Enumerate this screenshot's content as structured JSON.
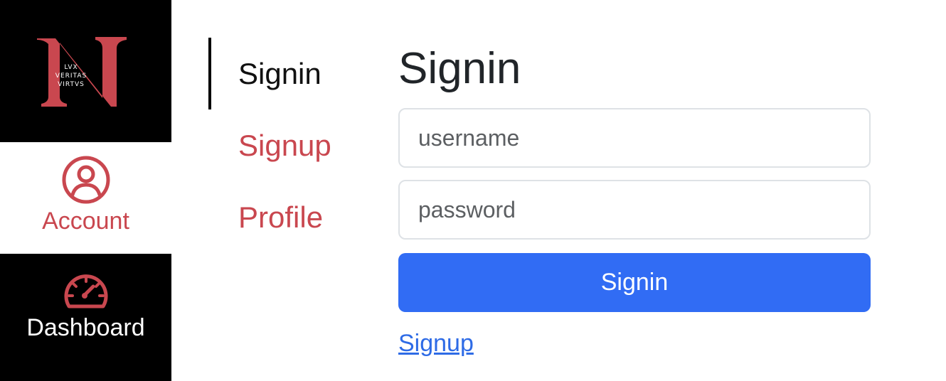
{
  "rail": {
    "logo": {
      "letter": "N",
      "motto_lines": [
        "LVX",
        "VERITAS",
        "VIRTVS"
      ]
    },
    "items": [
      {
        "label": "Account",
        "icon": "user-circle-icon",
        "active": true
      },
      {
        "label": "Dashboard",
        "icon": "speedometer-icon",
        "active": false
      }
    ]
  },
  "subnav": {
    "items": [
      {
        "label": "Signin",
        "active": true
      },
      {
        "label": "Signup",
        "active": false
      },
      {
        "label": "Profile",
        "active": false
      }
    ]
  },
  "form": {
    "title": "Signin",
    "username_placeholder": "username",
    "password_placeholder": "password",
    "username_value": "",
    "password_value": "",
    "submit_label": "Signin",
    "signup_link": "Signup"
  },
  "colors": {
    "accent_red": "#c9474f",
    "primary_blue": "#316cf4",
    "link_blue": "#2e6be6",
    "rail_black": "#000000"
  }
}
